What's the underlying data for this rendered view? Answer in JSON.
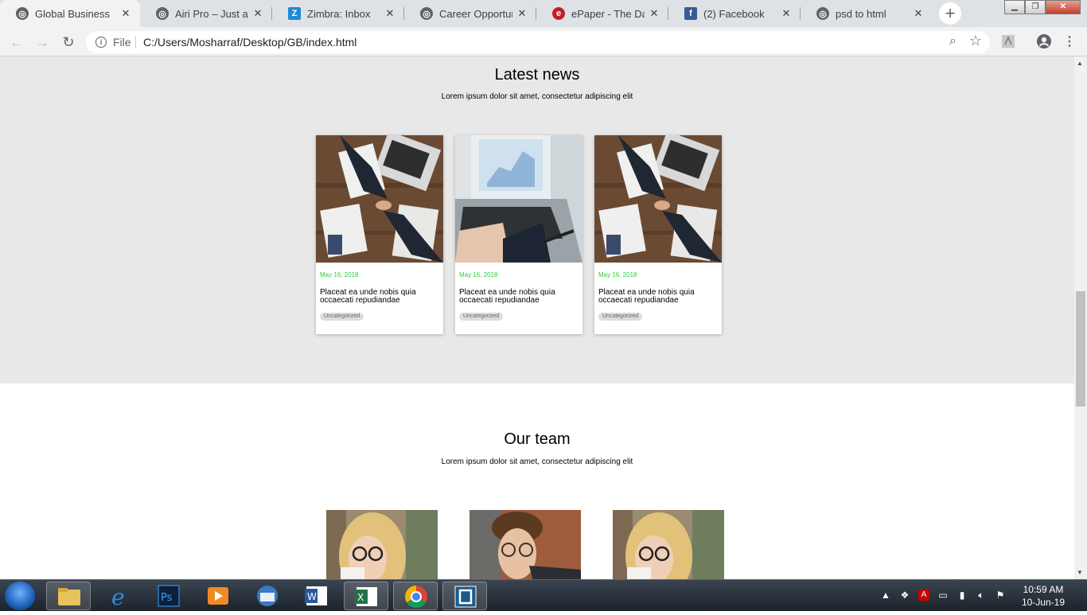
{
  "browser": {
    "tabs": [
      {
        "title": "Global Business",
        "icon": "globe-icon",
        "active": true
      },
      {
        "title": "Airi Pro – Just anoth",
        "icon": "globe-icon",
        "active": false
      },
      {
        "title": "Zimbra: Inbox",
        "icon": "zimbra-icon",
        "active": false
      },
      {
        "title": "Career Opportunity",
        "icon": "globe-icon",
        "active": false
      },
      {
        "title": "ePaper - The Daily",
        "icon": "epaper-icon",
        "active": false
      },
      {
        "title": "(2) Facebook",
        "icon": "facebook-icon",
        "active": false
      },
      {
        "title": "psd to html",
        "icon": "globe-icon",
        "active": false
      }
    ],
    "address": {
      "scheme_label": "File",
      "url": "C:/Users/Mosharraf/Desktop/GB/index.html"
    }
  },
  "news": {
    "title": "Latest news",
    "subtitle": "Lorem ipsum dolor sit amet, consectetur adipiscing elit",
    "cards": [
      {
        "date": "May 16, 2018",
        "title": "Placeat ea unde nobis quia occaecati repudiandae",
        "tag": "Uncategorized",
        "image": "handshake-desk-photo"
      },
      {
        "date": "May 16, 2018",
        "title": "Placeat ea unde nobis quia occaecati repudiandae",
        "tag": "Uncategorized",
        "image": "laptop-chart-photo"
      },
      {
        "date": "May 16, 2018",
        "title": "Placeat ea unde nobis quia occaecati repudiandae",
        "tag": "Uncategorized",
        "image": "handshake-desk-photo"
      }
    ]
  },
  "team": {
    "title": "Our team",
    "subtitle": "Lorem ipsum dolor sit amet, consectetur adipiscing elit",
    "members": [
      {
        "image": "woman-glasses-photo"
      },
      {
        "image": "man-glasses-photo"
      },
      {
        "image": "woman-glasses-photo"
      }
    ]
  },
  "taskbar": {
    "apps": [
      "windows-explorer-icon",
      "internet-explorer-icon",
      "photoshop-icon",
      "media-player-icon",
      "thunderbird-icon",
      "word-icon",
      "excel-icon",
      "chrome-icon",
      "app-window-icon"
    ],
    "time": "10:59 AM",
    "date": "10-Jun-19"
  },
  "colors": {
    "date_green": "#2ecc40",
    "news_bg": "#e8e8e8",
    "tabstrip": "#dee1e6"
  }
}
